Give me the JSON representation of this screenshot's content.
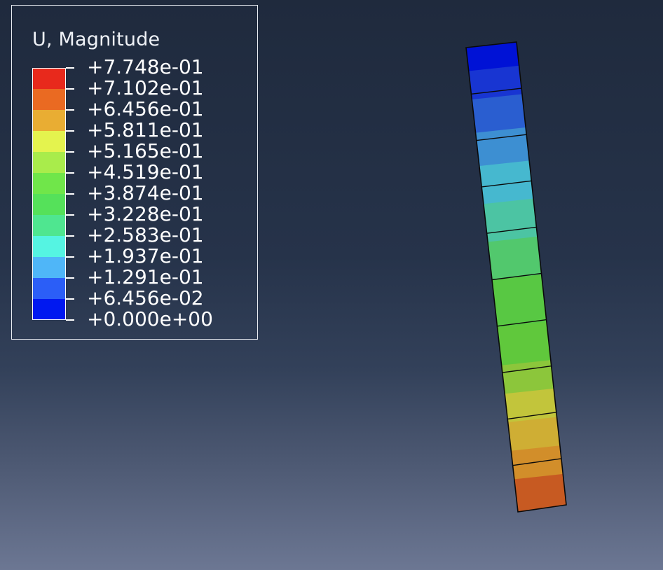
{
  "legend": {
    "title": "U, Magnitude",
    "bands": [
      {
        "color": "#e8291c"
      },
      {
        "color": "#ea6a22"
      },
      {
        "color": "#e9ad33"
      },
      {
        "color": "#e4f34e"
      },
      {
        "color": "#a9ec4b"
      },
      {
        "color": "#70e64a"
      },
      {
        "color": "#55e15a"
      },
      {
        "color": "#4fe690"
      },
      {
        "color": "#55f4e2"
      },
      {
        "color": "#4fb6f8"
      },
      {
        "color": "#2b5ef7"
      },
      {
        "color": "#0018f0"
      }
    ],
    "ticks": [
      "+7.748e-01",
      "+7.102e-01",
      "+6.456e-01",
      "+5.811e-01",
      "+5.165e-01",
      "+4.519e-01",
      "+3.874e-01",
      "+3.228e-01",
      "+2.583e-01",
      "+1.937e-01",
      "+1.291e-01",
      "+6.456e-02",
      "+0.000e+00"
    ]
  },
  "model": {
    "element_count": 10,
    "contour": [
      {
        "t": 0.0,
        "color": "#0012d6"
      },
      {
        "t": 0.06,
        "color": "#1835d2"
      },
      {
        "t": 0.12,
        "color": "#2a5ed0"
      },
      {
        "t": 0.19,
        "color": "#3d8fd2"
      },
      {
        "t": 0.26,
        "color": "#46b8cf"
      },
      {
        "t": 0.34,
        "color": "#4cc4a3"
      },
      {
        "t": 0.42,
        "color": "#52c86d"
      },
      {
        "t": 0.5,
        "color": "#58c843"
      },
      {
        "t": 0.6,
        "color": "#60c83c"
      },
      {
        "t": 0.68,
        "color": "#8cc63b"
      },
      {
        "t": 0.74,
        "color": "#c2c53b"
      },
      {
        "t": 0.8,
        "color": "#cfae34"
      },
      {
        "t": 0.86,
        "color": "#d28e2a"
      },
      {
        "t": 0.92,
        "color": "#c75a22"
      },
      {
        "t": 1.0,
        "color": "#c3261e"
      }
    ],
    "colors": {
      "edge": "#0a0a0a"
    }
  }
}
